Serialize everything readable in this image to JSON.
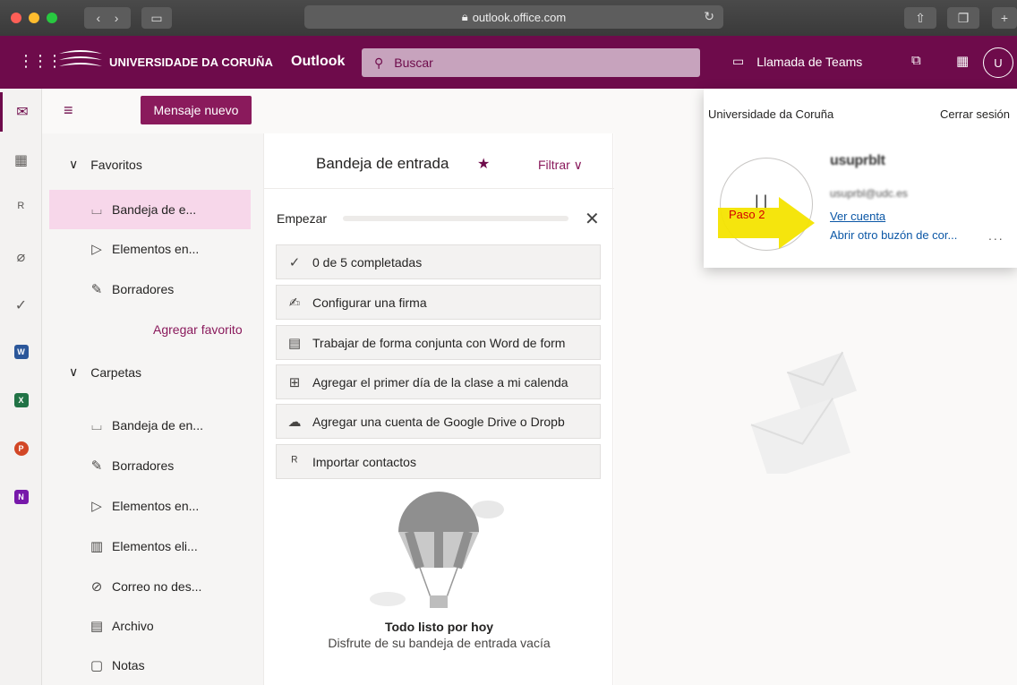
{
  "browser": {
    "url": "outlook.office.com",
    "lock_icon": "lock-icon",
    "colors": {
      "close": "#fe5f57",
      "minimize": "#febc2e",
      "zoom": "#28c840"
    }
  },
  "header": {
    "org_name": "UNIVERSIDADE DA CORUÑA",
    "app_name": "Outlook",
    "search_placeholder": "Buscar",
    "teams_label": "Llamada de Teams",
    "avatar_initials": "U",
    "accent": "#6e0b4b"
  },
  "rail": {
    "items": [
      "mail-icon",
      "calendar-icon",
      "people-icon",
      "attachment-icon",
      "todo-icon",
      "word-icon",
      "excel-icon",
      "powerpoint-icon",
      "onenote-icon"
    ],
    "word": "W",
    "excel": "X",
    "powerpoint": "P",
    "onenote": "N"
  },
  "commands": {
    "new_message": "Mensaje nuevo"
  },
  "folders": {
    "favorites_label": "Favoritos",
    "favorites": [
      {
        "label": "Bandeja de e...",
        "icon": "inbox-icon"
      },
      {
        "label": "Elementos en...",
        "icon": "sent-icon"
      },
      {
        "label": "Borradores",
        "icon": "drafts-icon"
      }
    ],
    "add_favorite": "Agregar favorito",
    "folders_label": "Carpetas",
    "items": [
      {
        "label": "Bandeja de en...",
        "icon": "inbox-icon"
      },
      {
        "label": "Borradores",
        "icon": "drafts-icon"
      },
      {
        "label": "Elementos en...",
        "icon": "sent-icon"
      },
      {
        "label": "Elementos eli...",
        "icon": "trash-icon"
      },
      {
        "label": "Correo no des...",
        "icon": "junk-icon"
      },
      {
        "label": "Archivo",
        "icon": "archive-icon"
      },
      {
        "label": "Notas",
        "icon": "notes-icon"
      }
    ]
  },
  "list": {
    "title": "Bandeja de entrada",
    "filter": "Filtrar",
    "start": "Empezar",
    "progress": 0,
    "tasks": [
      "0 de 5 completadas",
      "Configurar una firma",
      "Trabajar de forma conjunta con Word de form",
      "Agregar el primer día de la clase a mi calenda",
      "Agregar una cuenta de Google Drive o Dropb",
      "Importar contactos"
    ],
    "empty_title": "Todo listo por hoy",
    "empty_subtitle": "Disfrute de su bandeja de entrada vacía"
  },
  "flyout": {
    "org": "Universidade da Coruña",
    "sign_out": "Cerrar sesión",
    "name": "usuprblt",
    "email": "usuprbl@udc.es",
    "view_account": "Ver cuenta",
    "open_other": "Abrir otro buzón de cor...",
    "more": "...",
    "annotation": "Paso 2"
  }
}
